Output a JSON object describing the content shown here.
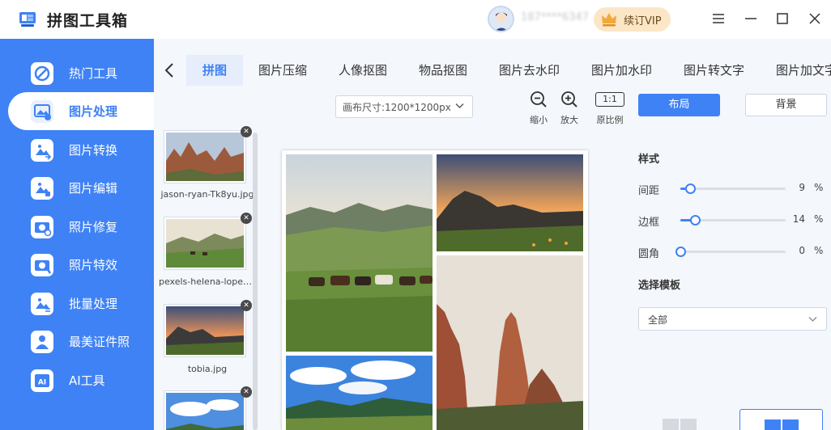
{
  "app": {
    "title": "拼图工具箱",
    "username": "187****6347",
    "vip_label": "续订VIP"
  },
  "sidebar": {
    "items": [
      {
        "label": "热门工具",
        "icon": "toolbox-icon"
      },
      {
        "label": "图片处理",
        "icon": "image-process-icon",
        "active": true
      },
      {
        "label": "图片转换",
        "icon": "image-convert-icon"
      },
      {
        "label": "图片编辑",
        "icon": "image-edit-icon"
      },
      {
        "label": "照片修复",
        "icon": "photo-repair-icon"
      },
      {
        "label": "照片特效",
        "icon": "photo-effect-icon"
      },
      {
        "label": "批量处理",
        "icon": "batch-icon"
      },
      {
        "label": "最美证件照",
        "icon": "id-photo-icon"
      },
      {
        "label": "AI工具",
        "icon": "ai-icon"
      }
    ]
  },
  "tabs": [
    {
      "label": "拼图",
      "active": true
    },
    {
      "label": "图片压缩"
    },
    {
      "label": "人像抠图"
    },
    {
      "label": "物品抠图"
    },
    {
      "label": "图片去水印"
    },
    {
      "label": "图片加水印"
    },
    {
      "label": "图片转文字"
    },
    {
      "label": "图片加文字"
    }
  ],
  "toolbar": {
    "canvas_size": "画布尺寸:1200*1200px",
    "zoom_out": "缩小",
    "zoom_in": "放大",
    "ratio_box": "1:1",
    "original_ratio": "原比例",
    "layout_button": "布局",
    "background_button": "背景"
  },
  "thumbnails": [
    {
      "name": "jason-ryan-Tk8yu.jpg"
    },
    {
      "name": "pexels-helena-lopes.jpg"
    },
    {
      "name": "tobia.jpg"
    },
    {
      "name": ""
    }
  ],
  "style_panel": {
    "title": "样式",
    "sliders": [
      {
        "label": "间距",
        "value": 9,
        "unit": "%",
        "fraction": 0.09
      },
      {
        "label": "边框",
        "value": 14,
        "unit": "%",
        "fraction": 0.14
      },
      {
        "label": "圆角",
        "value": 0,
        "unit": "%",
        "fraction": 0.0
      }
    ],
    "template_title": "选择模板",
    "template_select": "全部"
  },
  "colors": {
    "accent": "#3f82f5",
    "sidebar": "#3f82f5",
    "vip": "#fbe6c6"
  }
}
